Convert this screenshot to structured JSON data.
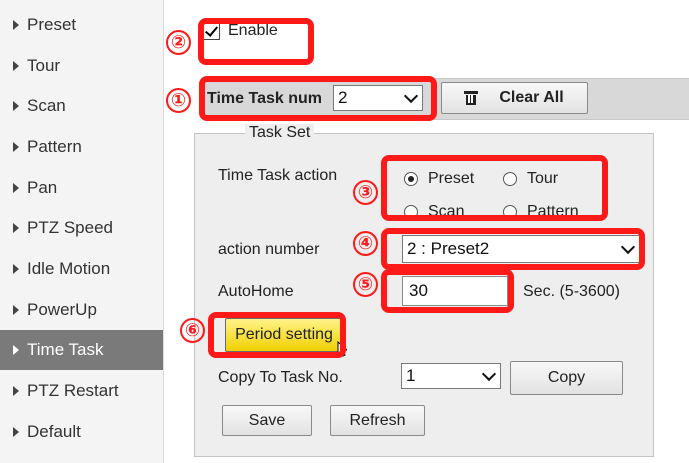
{
  "sidebar": {
    "items": [
      {
        "label": "Preset"
      },
      {
        "label": "Tour"
      },
      {
        "label": "Scan"
      },
      {
        "label": "Pattern"
      },
      {
        "label": "Pan"
      },
      {
        "label": "PTZ Speed"
      },
      {
        "label": "Idle Motion"
      },
      {
        "label": "PowerUp"
      },
      {
        "label": "Time Task",
        "active": true
      },
      {
        "label": "PTZ Restart"
      },
      {
        "label": "Default"
      }
    ]
  },
  "enable": {
    "label": "Enable",
    "checked": true
  },
  "task_num": {
    "label": "Time Task num",
    "value": "2"
  },
  "clear_all": {
    "label": "Clear All",
    "icon": "trash-icon"
  },
  "task_set": {
    "legend": "Task Set",
    "action_label": "Time Task action",
    "actions": [
      {
        "label": "Preset",
        "selected": true
      },
      {
        "label": "Tour",
        "selected": false
      },
      {
        "label": "Scan",
        "selected": false
      },
      {
        "label": "Pattern",
        "selected": false
      }
    ],
    "action_number_label": "action number",
    "action_number_value": "2 : Preset2",
    "autohome_label": "AutoHome",
    "autohome_value": "30",
    "autohome_unit": "Sec. (5-3600)",
    "period_setting": "Period setting",
    "copy_to_label": "Copy To Task No.",
    "copy_to_value": "1",
    "copy_button": "Copy",
    "save_button": "Save",
    "refresh_button": "Refresh"
  },
  "annotations": [
    "①",
    "②",
    "③",
    "④",
    "⑤",
    "⑥"
  ],
  "colors": {
    "highlight": "#ff1a1a",
    "active_sidebar": "#7a7a7a",
    "period_button": "#f5d800"
  }
}
